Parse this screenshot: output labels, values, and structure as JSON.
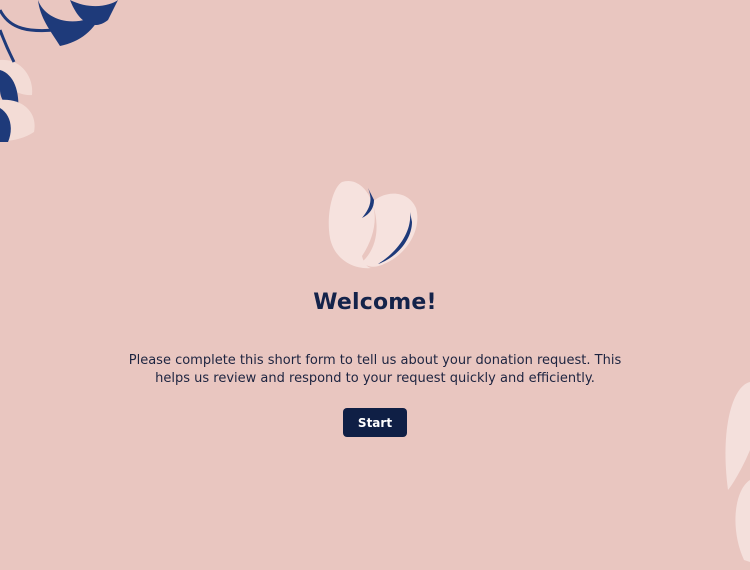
{
  "welcome": {
    "title": "Welcome!",
    "description": "Please complete this short form to tell us about your donation request. This helps us review and respond to your request quickly and efficiently.",
    "start_label": "Start"
  },
  "colors": {
    "background": "#e9c6c0",
    "navy": "#14234a",
    "blush": "#f6e2de"
  },
  "icons": {
    "logo": "heart-leaf-logo",
    "decoration": "leaf-icon"
  }
}
